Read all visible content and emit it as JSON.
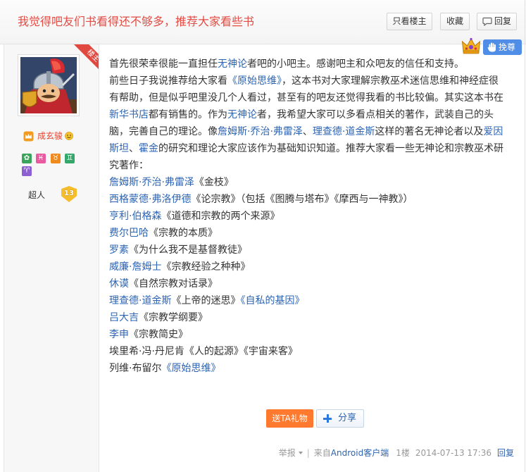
{
  "header": {
    "title": "我觉得吧友们书看得还不够多，推荐大家看些书",
    "only_author_label": "只看楼主",
    "favorite_label": "收藏",
    "reply_label": "回复",
    "reply_icon": "comment-icon"
  },
  "author": {
    "floor_badge": "楼主",
    "avatar": "avatar-image",
    "member_icon": "member-badge-icon",
    "username": "成玄骏",
    "emoji_icon": "smile-emoji-icon",
    "badge_icons": [
      "flower-badge-icon",
      "pisces-icon",
      "taurus-icon",
      "gemini-icon",
      "aries-icon"
    ],
    "level_name": "超人",
    "level": "13"
  },
  "post": {
    "support_icon": "crown-icon",
    "support_hand_icon": "hand-icon",
    "support_label": "挽尊",
    "lines": [
      [
        {
          "text": "首先很荣幸很能一直担任"
        },
        {
          "text": "无神论",
          "link": true
        },
        {
          "text": "者吧的小吧主。感谢吧主和众吧友的信任和支持。"
        }
      ],
      [
        {
          "text": "前些日子我说推荐给大家看"
        },
        {
          "text": "《原始思维》",
          "link": true
        },
        {
          "text": "，这本书对大家理解宗教巫术迷信思维和神经症很"
        }
      ],
      [
        {
          "text": "有帮助，但是似乎吧里没几个人看过，甚至有的吧友还觉得我看的书比较偏。其实这本书在"
        }
      ],
      [
        {
          "text": "新华书店",
          "link": true
        },
        {
          "text": "都有销售的。作为"
        },
        {
          "text": "无神论",
          "link": true
        },
        {
          "text": "者，我希望大家可以多看点相关的著作，武装自己的头"
        }
      ],
      [
        {
          "text": "脑，完善自己的理论。像"
        },
        {
          "text": "詹姆斯·乔治·弗雷泽",
          "link": true
        },
        {
          "text": "、"
        },
        {
          "text": "理查德·道金斯",
          "link": true
        },
        {
          "text": "这样的著名无神论者以及"
        },
        {
          "text": "爱因",
          "link": true
        }
      ],
      [
        {
          "text": "斯坦",
          "link": true
        },
        {
          "text": "、"
        },
        {
          "text": "霍金",
          "link": true
        },
        {
          "text": "的研究和理论大家应该作为基础知识知道。推荐大家看一些无神论和宗教巫术研"
        }
      ],
      [
        {
          "text": "究著作："
        }
      ],
      [
        {
          "text": "詹姆斯·乔治·弗雷泽",
          "link": true
        },
        {
          "text": "《金枝》"
        }
      ],
      [
        {
          "text": "西格蒙德·弗洛伊德",
          "link": true
        },
        {
          "text": "《论宗教》（包括《图腾与塔布》《摩西与一神教》）"
        }
      ],
      [
        {
          "text": "亨利·伯格森",
          "link": true
        },
        {
          "text": "《道德和宗教的两个来源》"
        }
      ],
      [
        {
          "text": "费尔巴哈",
          "link": true
        },
        {
          "text": "《宗教的本质》"
        }
      ],
      [
        {
          "text": "罗素",
          "link": true
        },
        {
          "text": "《为什么我不是基督教徒》"
        }
      ],
      [
        {
          "text": "威廉·詹姆士",
          "link": true
        },
        {
          "text": "《宗教经验之种种》"
        }
      ],
      [
        {
          "text": "休谟",
          "link": true
        },
        {
          "text": "《自然宗教对话录》"
        }
      ],
      [
        {
          "text": "理查德·道金斯",
          "link": true
        },
        {
          "text": "《上帝的迷思》"
        },
        {
          "text": "《自私的基因》",
          "link": true
        }
      ],
      [
        {
          "text": "吕大吉",
          "link": true
        },
        {
          "text": "《宗教学纲要》"
        }
      ],
      [
        {
          "text": "李申",
          "link": true
        },
        {
          "text": "《宗教简史》"
        }
      ],
      [
        {
          "text": "埃里希·冯·丹尼肯《人的起源》《宇宙来客》"
        }
      ],
      [
        {
          "text": "列维·布留尔"
        },
        {
          "text": "《原始思维》",
          "link": true
        }
      ]
    ]
  },
  "actions": {
    "gift_label": "送TA礼物",
    "share_label": "分享",
    "share_icon": "plus-icon"
  },
  "footer": {
    "report_label": "举报",
    "report_icon": "caret-down-icon",
    "separator": "|",
    "source_prefix": "来自",
    "source_client": "Android客户端",
    "floor": "1楼",
    "time": "2014-07-13 17:36",
    "reply_label": "回复"
  },
  "colors": {
    "title": "#e34b43",
    "link": "#2d64b3",
    "text": "#333333",
    "username": "#e8422c",
    "floor_badge": "#e1483f",
    "gift_button": "#ff7a2e",
    "support_button": "#4f8de6",
    "level_badge": "#f5bd2c"
  }
}
